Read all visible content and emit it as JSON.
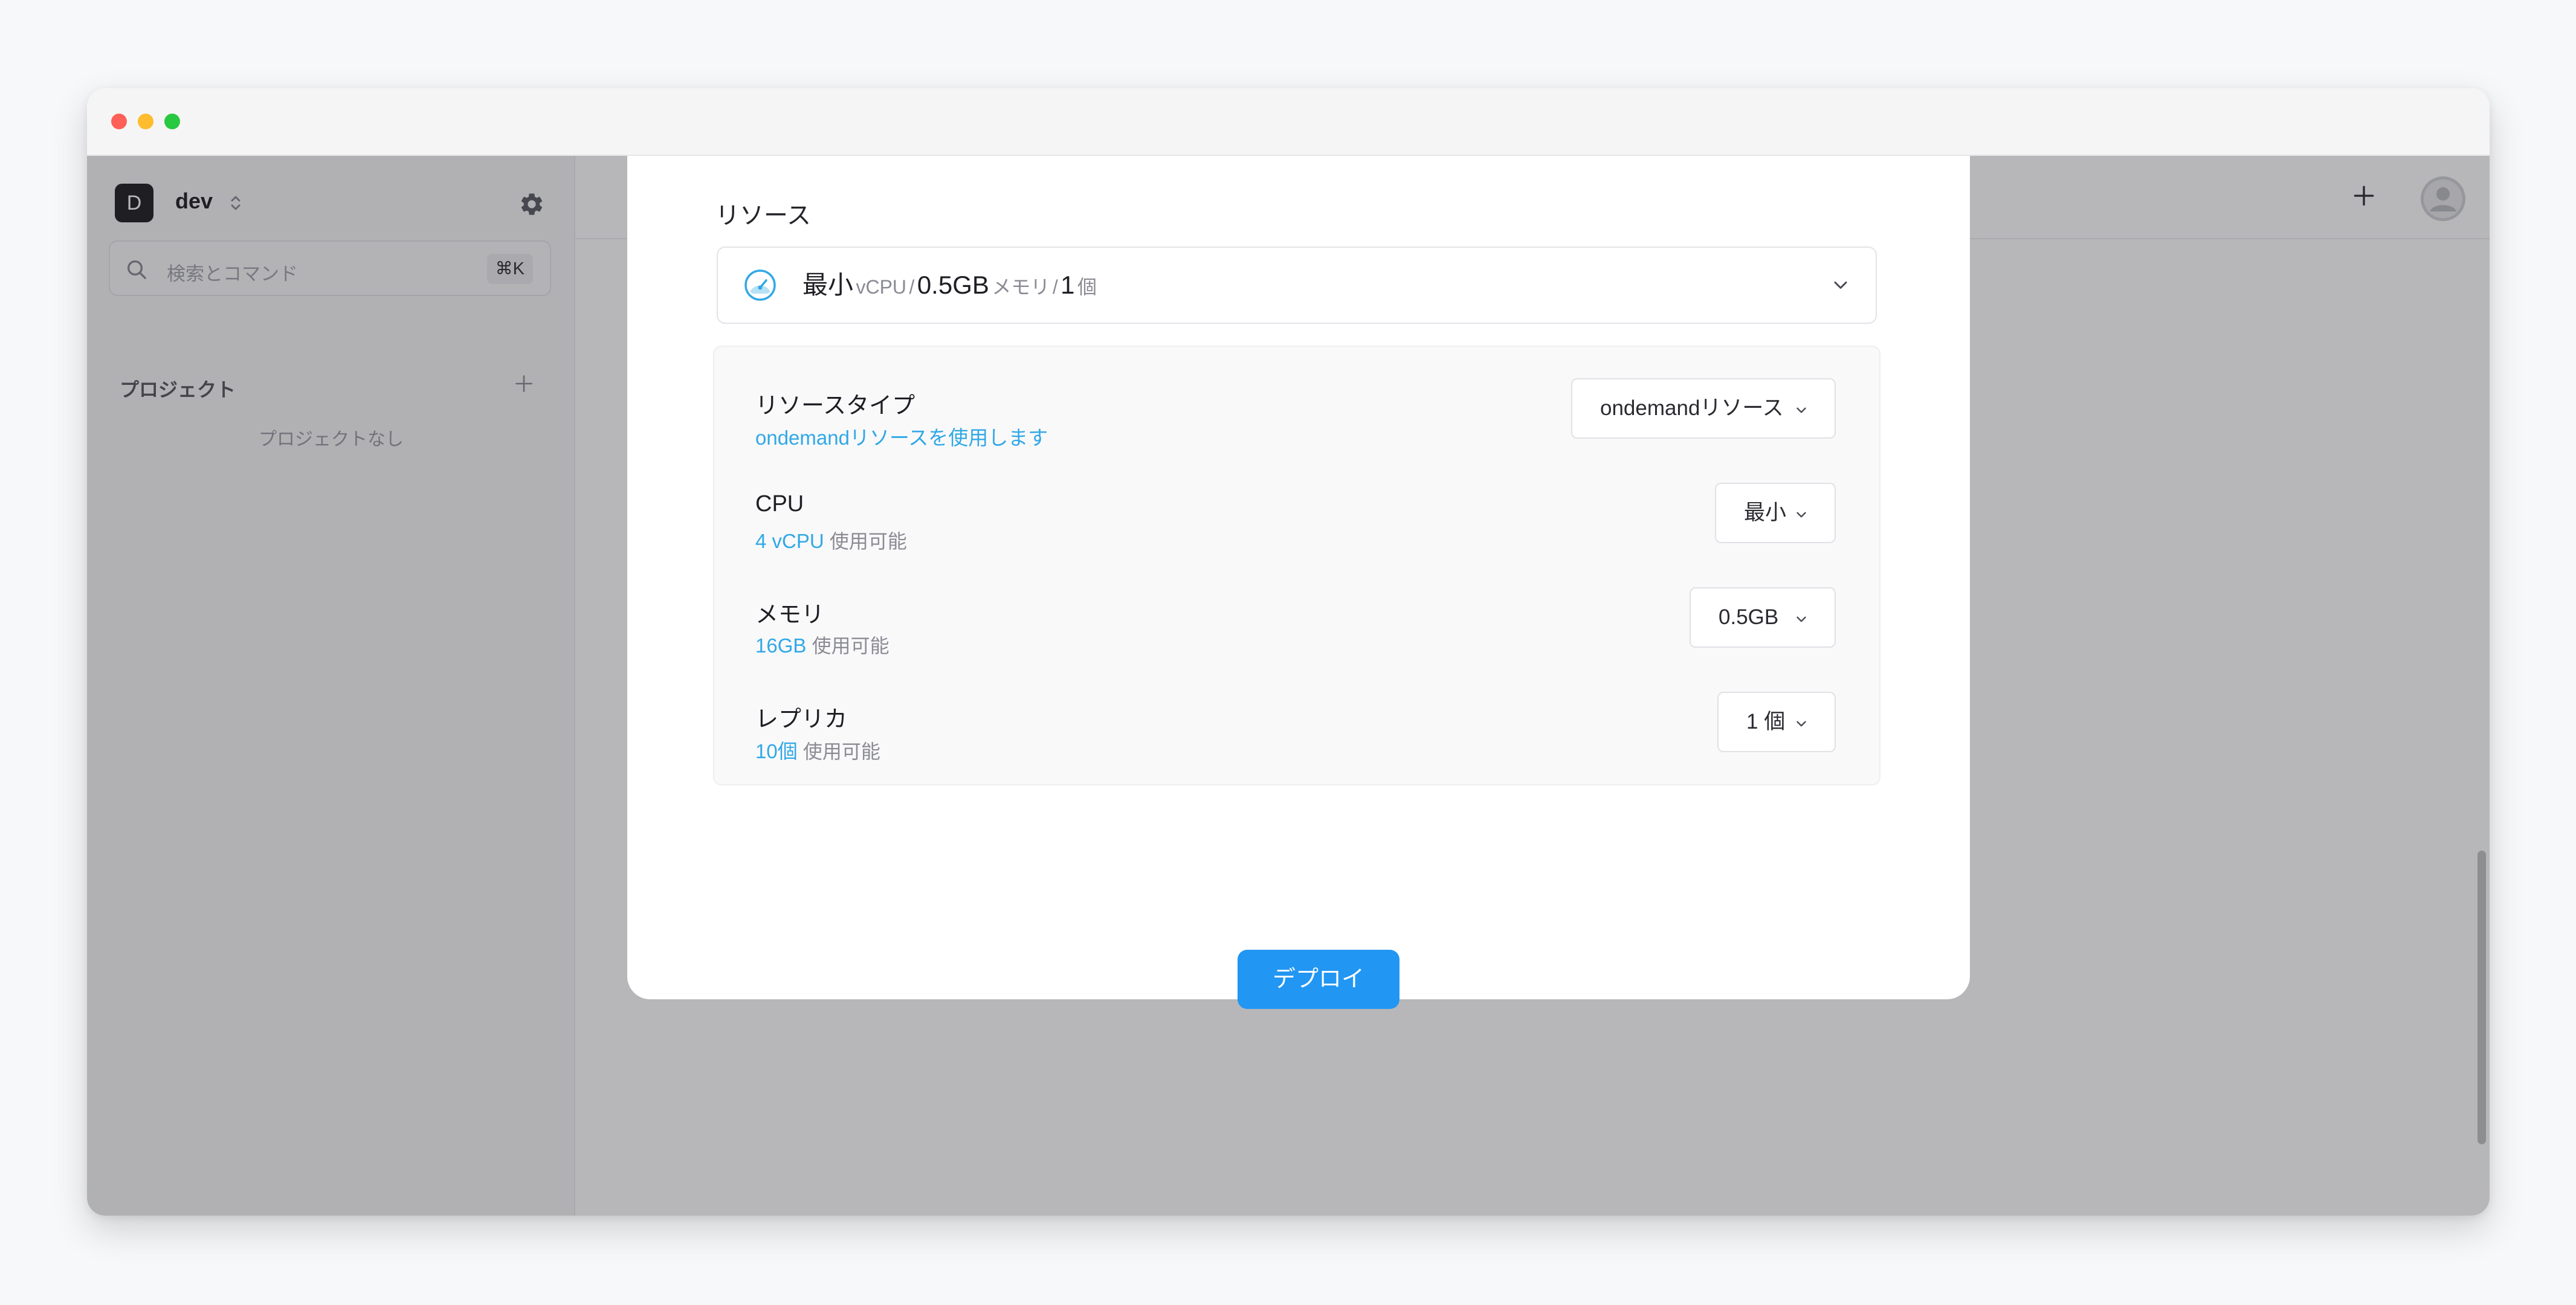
{
  "colors": {
    "accent": "#2196f3",
    "link": "#30a8e6",
    "overlay": "rgba(30,30,36,0.32)"
  },
  "sidebar": {
    "workspace_initial": "D",
    "workspace_name": "dev",
    "search_placeholder": "検索とコマンド",
    "search_shortcut": "⌘K",
    "projects_label": "プロジェクト",
    "projects_empty": "プロジェクトなし"
  },
  "header": {
    "icons": [
      "plus-icon",
      "user-avatar-icon"
    ]
  },
  "modal": {
    "section_title": "リソース",
    "summary": {
      "cpu_value": "最小",
      "cpu_unit": "vCPU",
      "memory_value": "0.5GB",
      "memory_unit": "メモリ",
      "replica_value": "1",
      "replica_unit": "個",
      "separator": "/"
    },
    "rows": [
      {
        "label": "リソースタイプ",
        "sub_highlight": "ondemandリソースを使用します",
        "sub_muted": "",
        "value": "ondemandリソース"
      },
      {
        "label": "CPU",
        "sub_highlight": "4 vCPU",
        "sub_muted": "使用可能",
        "value": "最小"
      },
      {
        "label": "メモリ",
        "sub_highlight": "16GB",
        "sub_muted": "使用可能",
        "value": "0.5GB"
      },
      {
        "label": "レプリカ",
        "sub_highlight": "10個",
        "sub_muted": "使用可能",
        "value": "1 個"
      }
    ],
    "deploy_label": "デプロイ"
  }
}
